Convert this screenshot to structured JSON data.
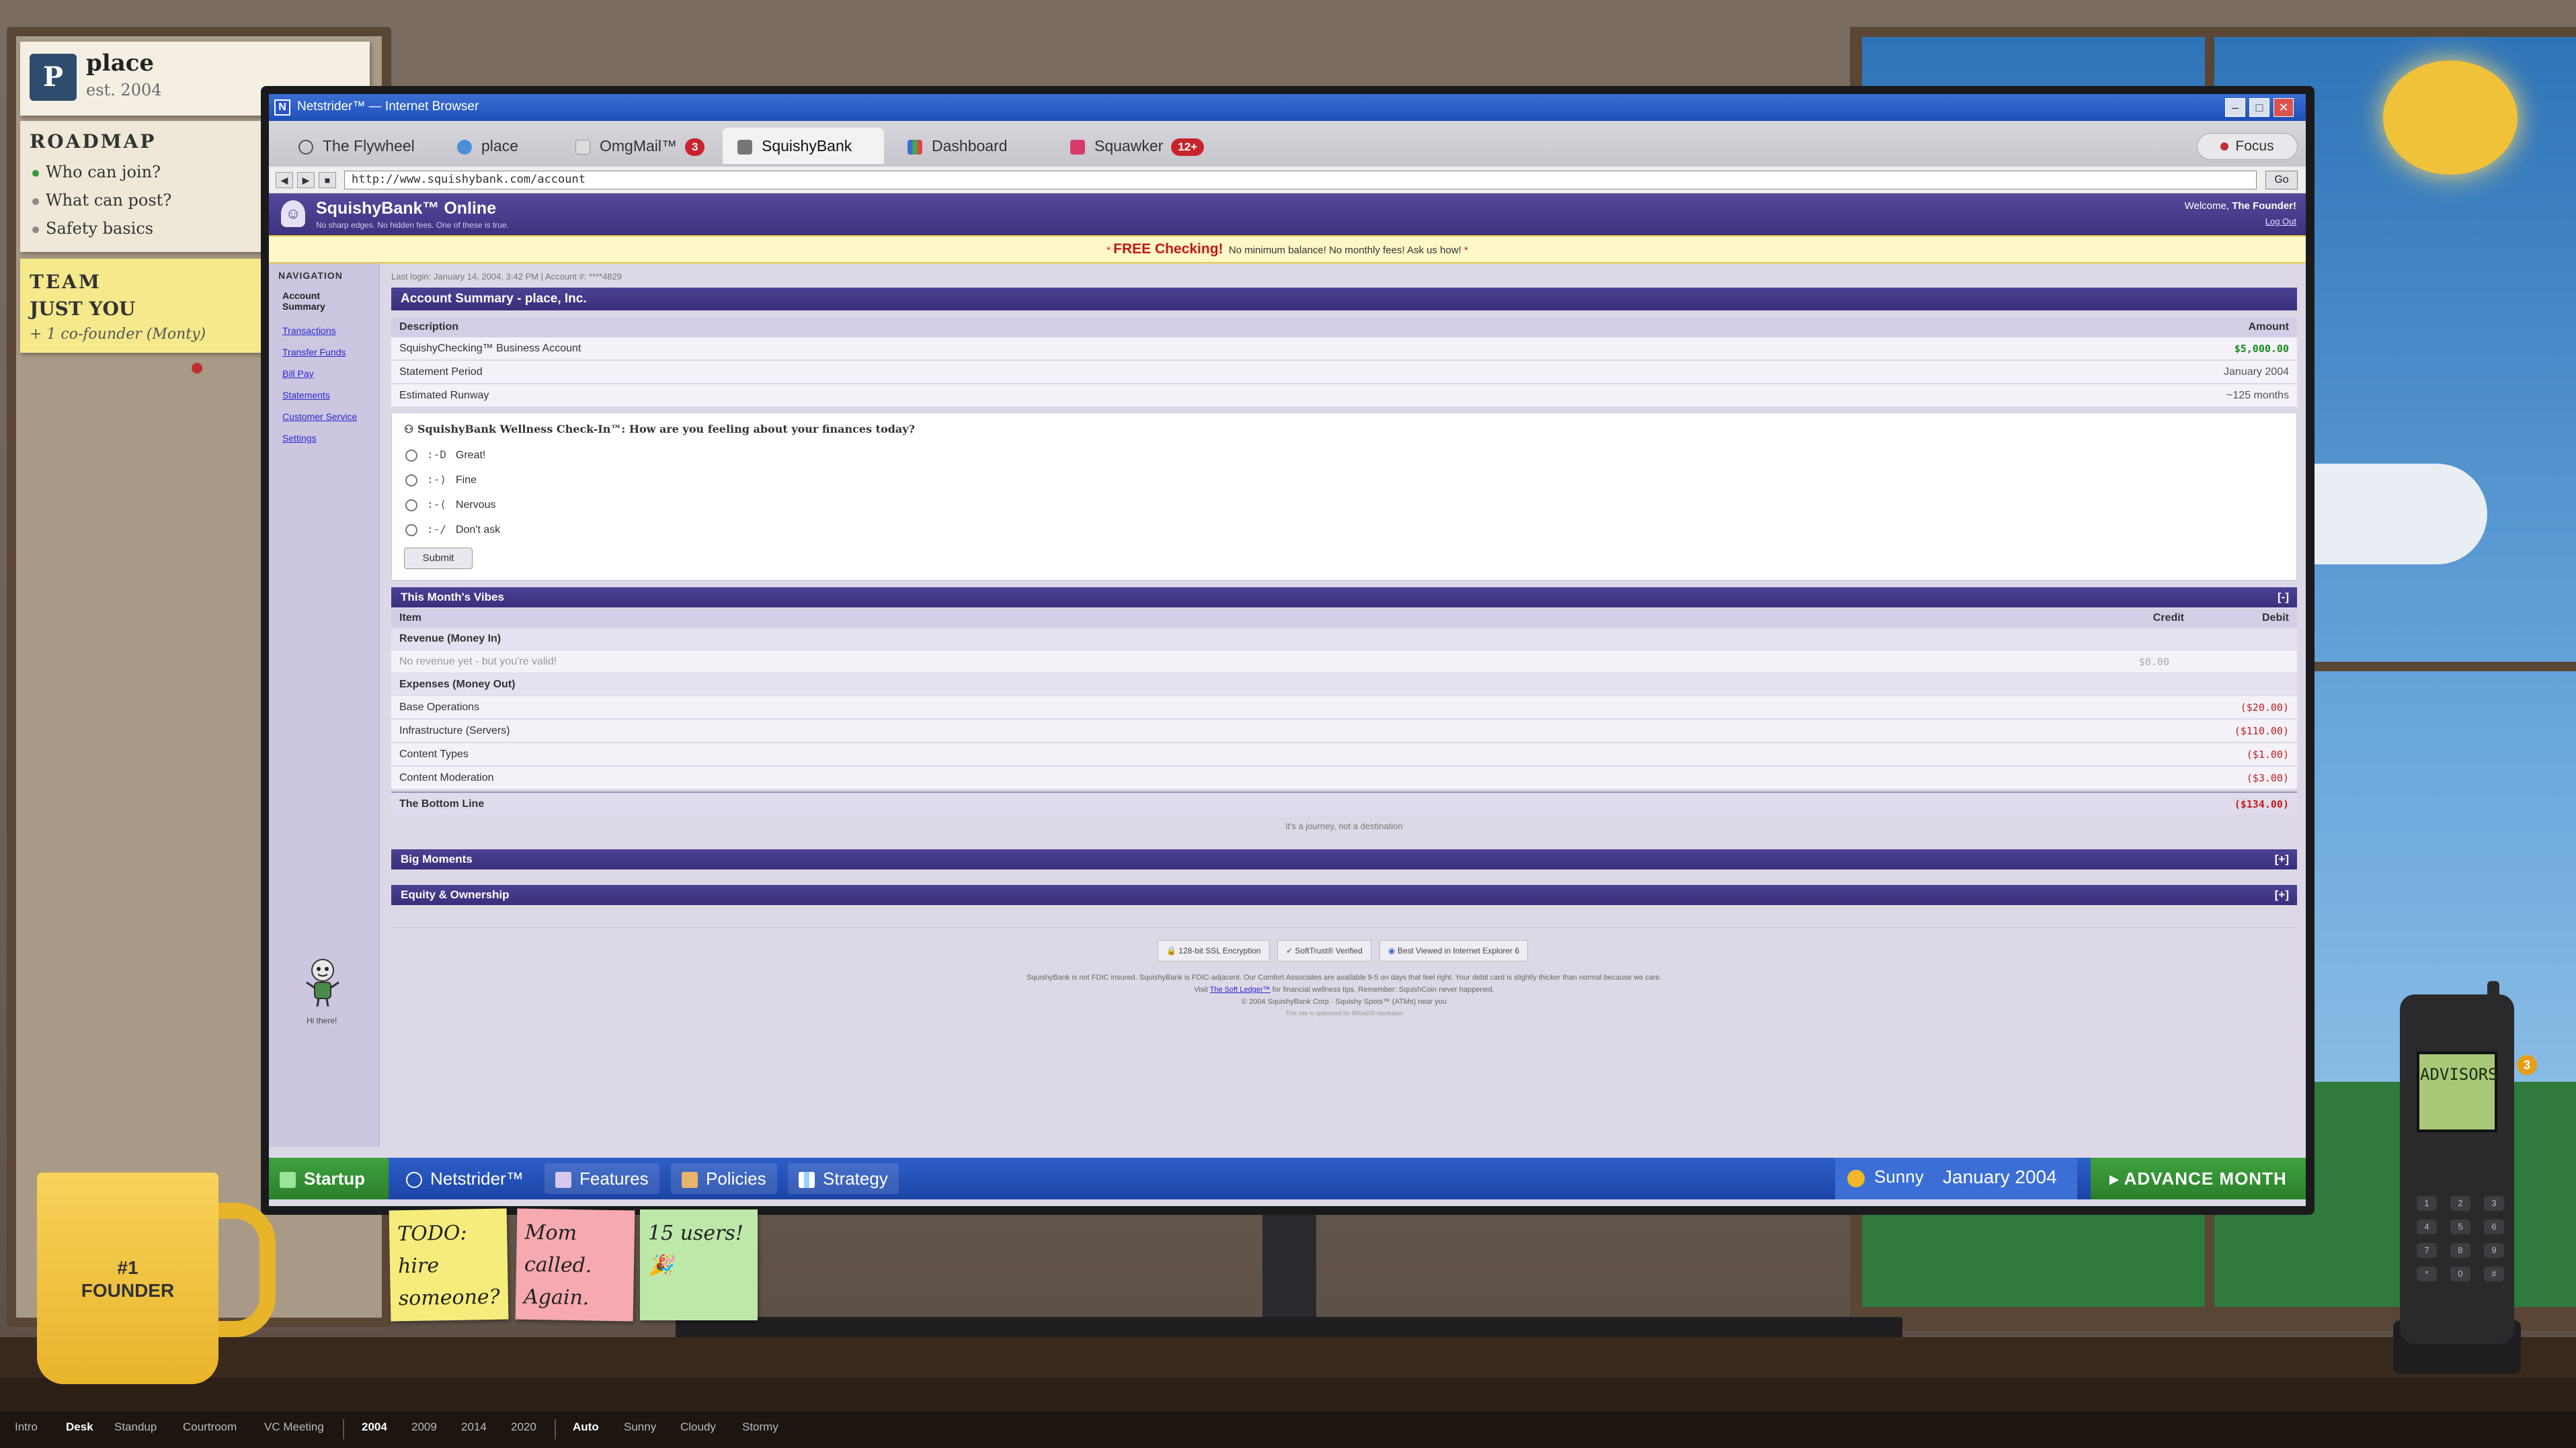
{
  "corkboard": {
    "logo_letter": "P",
    "title": "place",
    "est": "est. 2004",
    "roadmap_title": "ROADMAP",
    "roadmap_items": [
      "Who can join?",
      "What can post?",
      "Safety basics"
    ],
    "team_title": "TEAM",
    "team_sub": "JUST YOU",
    "team_note": "+ 1 co-founder (Monty)"
  },
  "browser": {
    "title": "Netstrider™ — Internet Browser",
    "tabs": [
      {
        "label": "The Flywheel",
        "badge": ""
      },
      {
        "label": "place",
        "badge": ""
      },
      {
        "label": "OmgMail™",
        "badge": "3"
      },
      {
        "label": "SquishyBank",
        "badge": ""
      },
      {
        "label": "Dashboard",
        "badge": ""
      },
      {
        "label": "Squawker",
        "badge": "12+"
      }
    ],
    "focus_label": "Focus",
    "url": "http://www.squishybank.com/account",
    "go_label": "Go"
  },
  "bank": {
    "name": "SquishyBank™ Online",
    "tagline": "No sharp edges. No hidden fees. One of these is true.",
    "welcome_prefix": "Welcome, ",
    "welcome_user": "The Founder!",
    "logout": "Log Out",
    "promo_strong": "FREE Checking!",
    "promo_text": "No minimum balance! No monthly fees! Ask us how!",
    "nav_title": "NAVIGATION",
    "nav_items": [
      "Account Summary",
      "Transactions",
      "Transfer Funds",
      "Bill Pay",
      "Statements",
      "Customer Service",
      "Settings"
    ],
    "mascot_caption": "Hi there!",
    "last_login": "Last login: January 14, 2004, 3:42 PM | Account #: ****4829",
    "summary": {
      "title": "Account Summary - place, Inc.",
      "col_desc": "Description",
      "col_amount": "Amount",
      "rows": [
        {
          "desc": "SquishyChecking™ Business Account",
          "amount": "$5,000.00"
        },
        {
          "desc": "Statement Period",
          "amount": "January 2004"
        },
        {
          "desc": "Estimated Runway",
          "amount": "~125 months"
        }
      ]
    },
    "wellness": {
      "question": "SquishyBank Wellness Check-In™: How are you feeling about your finances today?",
      "options": [
        {
          "emote": ":-D",
          "label": "Great!"
        },
        {
          "emote": ":-)",
          "label": "Fine"
        },
        {
          "emote": ":-(",
          "label": "Nervous"
        },
        {
          "emote": ":-/",
          "label": "Don't ask"
        }
      ],
      "submit": "Submit"
    },
    "vibes": {
      "title": "This Month's Vibes",
      "toggle": "[-]",
      "col_item": "Item",
      "col_credit": "Credit",
      "col_debit": "Debit",
      "revenue_heading": "Revenue (Money In)",
      "revenue_empty": "No revenue yet - but you're valid!",
      "revenue_empty_credit": "$0.00",
      "expenses_heading": "Expenses (Money Out)",
      "expenses": [
        {
          "item": "Base Operations",
          "debit": "($20.00)"
        },
        {
          "item": "Infrastructure (Servers)",
          "debit": "($110.00)"
        },
        {
          "item": "Content Types",
          "debit": "($1.00)"
        },
        {
          "item": "Content Moderation",
          "debit": "($3.00)"
        }
      ],
      "bottom_label": "The Bottom Line",
      "bottom_value": "($134.00)",
      "caption": "it's a journey, not a destination"
    },
    "big_moments": {
      "title": "Big Moments",
      "toggle": "[+]"
    },
    "equity": {
      "title": "Equity & Ownership",
      "toggle": "[+]"
    },
    "footer": {
      "badges": [
        "128-bit SSL Encryption",
        "✓ SoftTrust® Verified",
        "Best Viewed in Internet Explorer 6"
      ],
      "line1": "SquishyBank is not FDIC insured. SquishyBank is FDIC-adjacent. Our Comfort Associates are available 9-5 on days that feel right. Your debit card is slightly thicker than normal because we care.",
      "line2_pre": "Visit ",
      "line2_link": "The Soft Ledger™",
      "line2_post": " for financial wellness tips. Remember: SquishCoin never happened.",
      "line3": "© 2004 SquishyBank Corp · Squishy Spots™ (ATMs) near you",
      "line4": "This site is optimized for 800x600 resolution"
    }
  },
  "taskbar": {
    "start": "Startup",
    "items": [
      "Netstrider™",
      "Features",
      "Policies",
      "Strategy"
    ],
    "weather": "Sunny",
    "date": "January 2004",
    "advance": "ADVANCE MONTH"
  },
  "desk": {
    "mug_text": "#1\nFOUNDER",
    "stickies": [
      "TODO: hire someone?",
      "Mom called. Again.",
      "15 users! 🎉"
    ],
    "phone_label": "ADVISORS",
    "phone_badge": "3"
  },
  "scenebar": {
    "scenes": [
      "Intro",
      "Desk",
      "Standup",
      "Courtroom",
      "VC Meeting"
    ],
    "years": [
      "2004",
      "2009",
      "2014",
      "2020"
    ],
    "weathers": [
      "Auto",
      "Sunny",
      "Cloudy",
      "Stormy"
    ],
    "active_scene": "Desk",
    "active_year": "2004",
    "active_weather": "Auto"
  },
  "colors": {
    "bank_purple": "#3d3280",
    "promo_red": "#c01818",
    "credit_green": "#1a8a1a",
    "debit_red": "#c02020",
    "taskbar_blue": "#1f4fb8",
    "advance_green": "#2a7f2a"
  }
}
